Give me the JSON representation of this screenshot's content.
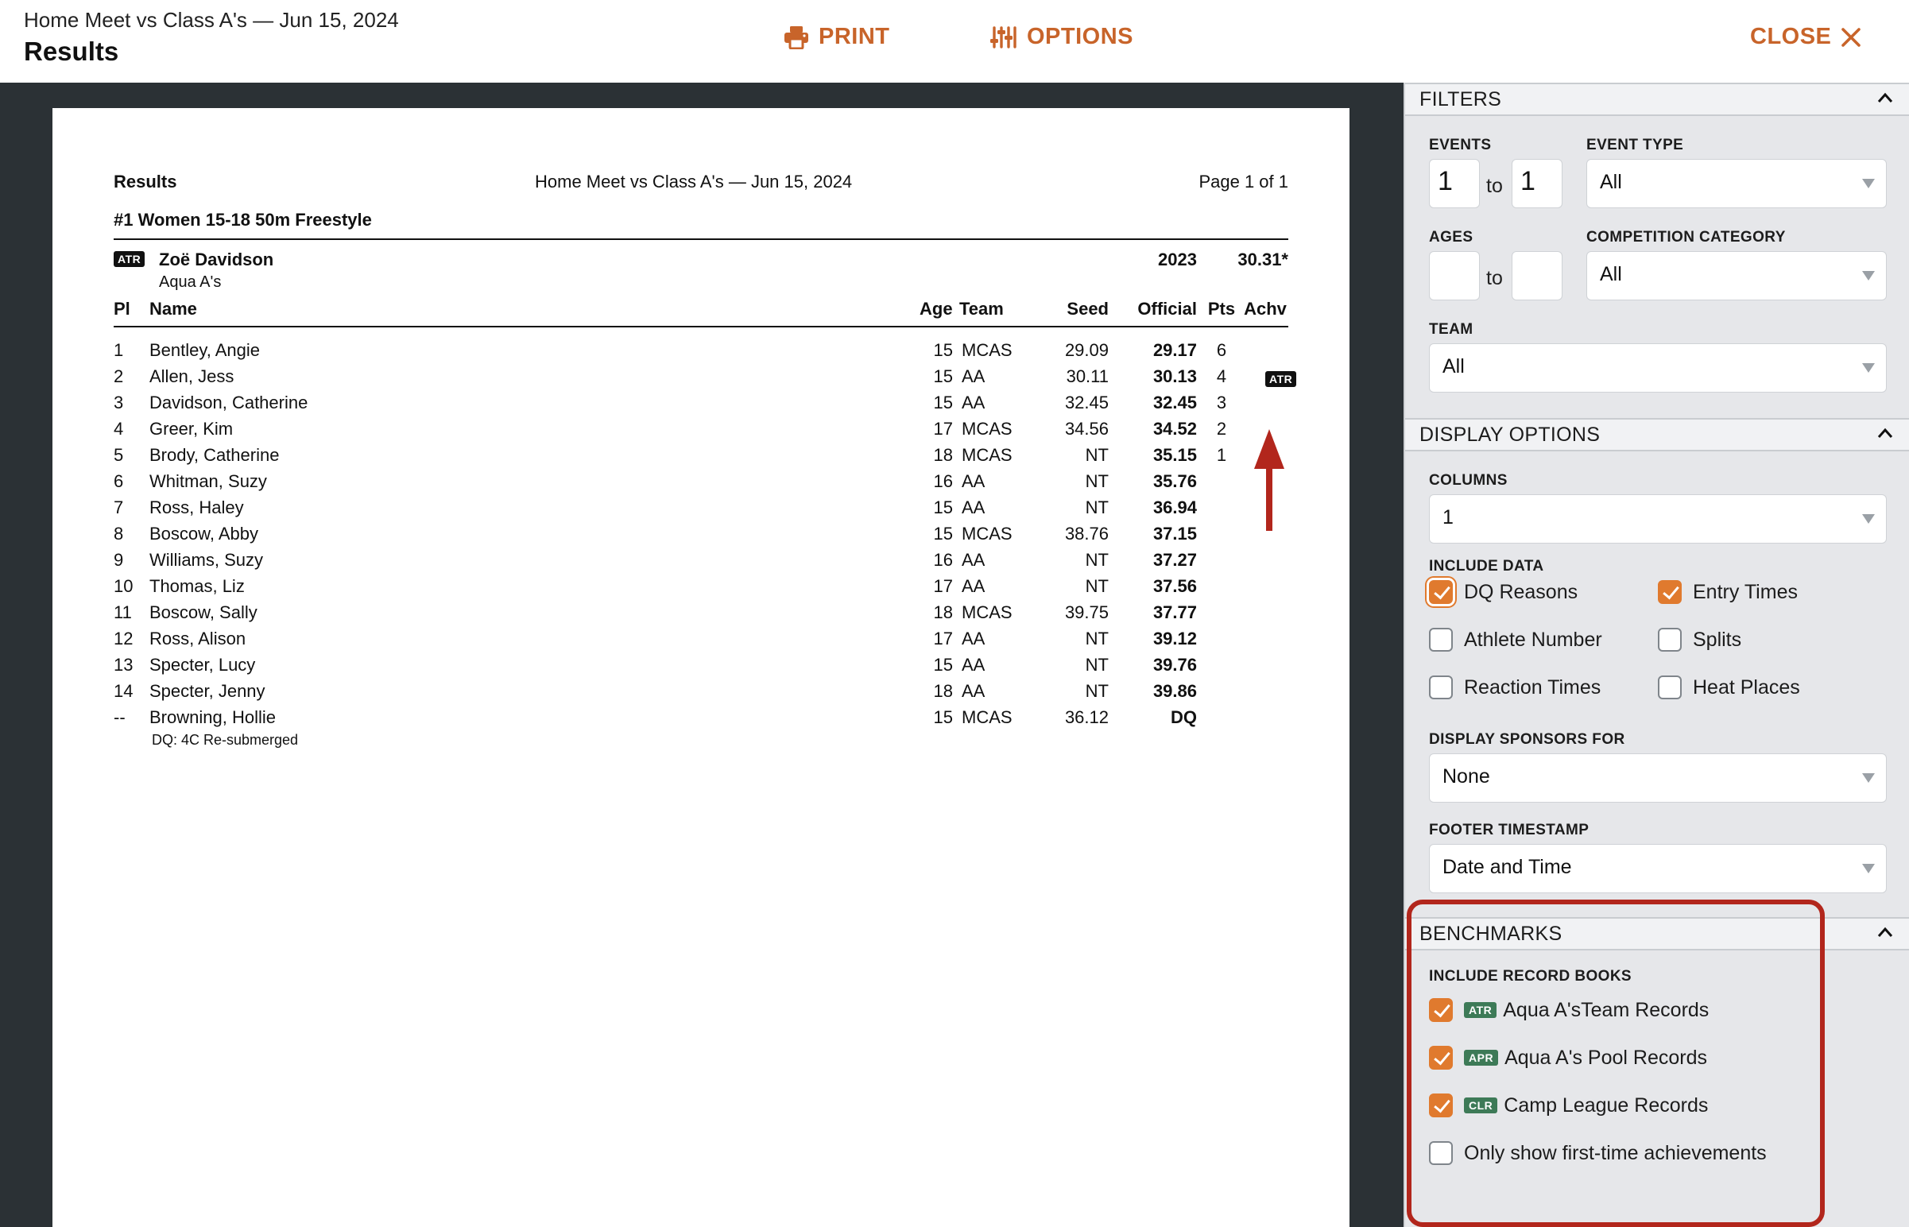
{
  "header": {
    "subtitle": "Home Meet vs Class A's — Jun 15, 2024",
    "title": "Results",
    "print_label": "PRINT",
    "options_label": "OPTIONS",
    "close_label": "CLOSE",
    "accent_color": "#c8642a"
  },
  "document": {
    "head_left": "Results",
    "head_mid": "Home Meet vs Class A's — Jun 15, 2024",
    "head_right": "Page 1 of 1",
    "event_title": "#1 Women 15-18 50m Freestyle",
    "record": {
      "badge": "ATR",
      "name": "Zoë Davidson",
      "team": "Aqua A's",
      "year": "2023",
      "time": "30.31*"
    },
    "columns": {
      "pl": "Pl",
      "name": "Name",
      "age": "Age",
      "team": "Team",
      "seed": "Seed",
      "official": "Official",
      "pts": "Pts",
      "achv": "Achv"
    },
    "rows": [
      {
        "pl": "1",
        "name": "Bentley, Angie",
        "age": "15",
        "team": "MCAS",
        "seed": "29.09",
        "official": "29.17",
        "pts": "6",
        "achv": ""
      },
      {
        "pl": "2",
        "name": "Allen, Jess",
        "age": "15",
        "team": "AA",
        "seed": "30.11",
        "official": "30.13",
        "pts": "4",
        "achv": "ATR"
      },
      {
        "pl": "3",
        "name": "Davidson, Catherine",
        "age": "15",
        "team": "AA",
        "seed": "32.45",
        "official": "32.45",
        "pts": "3",
        "achv": ""
      },
      {
        "pl": "4",
        "name": "Greer, Kim",
        "age": "17",
        "team": "MCAS",
        "seed": "34.56",
        "official": "34.52",
        "pts": "2",
        "achv": ""
      },
      {
        "pl": "5",
        "name": "Brody, Catherine",
        "age": "18",
        "team": "MCAS",
        "seed": "NT",
        "official": "35.15",
        "pts": "1",
        "achv": ""
      },
      {
        "pl": "6",
        "name": "Whitman, Suzy",
        "age": "16",
        "team": "AA",
        "seed": "NT",
        "official": "35.76",
        "pts": "",
        "achv": ""
      },
      {
        "pl": "7",
        "name": "Ross, Haley",
        "age": "15",
        "team": "AA",
        "seed": "NT",
        "official": "36.94",
        "pts": "",
        "achv": ""
      },
      {
        "pl": "8",
        "name": "Boscow, Abby",
        "age": "15",
        "team": "MCAS",
        "seed": "38.76",
        "official": "37.15",
        "pts": "",
        "achv": ""
      },
      {
        "pl": "9",
        "name": "Williams, Suzy",
        "age": "16",
        "team": "AA",
        "seed": "NT",
        "official": "37.27",
        "pts": "",
        "achv": ""
      },
      {
        "pl": "10",
        "name": "Thomas, Liz",
        "age": "17",
        "team": "AA",
        "seed": "NT",
        "official": "37.56",
        "pts": "",
        "achv": ""
      },
      {
        "pl": "11",
        "name": "Boscow, Sally",
        "age": "18",
        "team": "MCAS",
        "seed": "39.75",
        "official": "37.77",
        "pts": "",
        "achv": ""
      },
      {
        "pl": "12",
        "name": "Ross, Alison",
        "age": "17",
        "team": "AA",
        "seed": "NT",
        "official": "39.12",
        "pts": "",
        "achv": ""
      },
      {
        "pl": "13",
        "name": "Specter, Lucy",
        "age": "15",
        "team": "AA",
        "seed": "NT",
        "official": "39.76",
        "pts": "",
        "achv": ""
      },
      {
        "pl": "14",
        "name": "Specter, Jenny",
        "age": "18",
        "team": "AA",
        "seed": "NT",
        "official": "39.86",
        "pts": "",
        "achv": ""
      },
      {
        "pl": "--",
        "name": "Browning, Hollie",
        "age": "15",
        "team": "MCAS",
        "seed": "36.12",
        "official": "DQ",
        "pts": "",
        "achv": ""
      }
    ],
    "dq_note": "DQ: 4C Re-submerged"
  },
  "filters": {
    "section_title": "FILTERS",
    "events_label": "EVENTS",
    "events_from": "1",
    "events_to": "1",
    "to_label": "to",
    "event_type_label": "EVENT TYPE",
    "event_type_value": "All",
    "ages_label": "AGES",
    "ages_from": "",
    "ages_to": "",
    "competition_label": "COMPETITION CATEGORY",
    "competition_value": "All",
    "team_label": "TEAM",
    "team_value": "All"
  },
  "display": {
    "section_title": "DISPLAY OPTIONS",
    "columns_label": "COLUMNS",
    "columns_value": "1",
    "include_data_label": "INCLUDE DATA",
    "dq_reasons": "DQ Reasons",
    "entry_times": "Entry Times",
    "athlete_number": "Athlete Number",
    "splits": "Splits",
    "reaction_times": "Reaction Times",
    "heat_places": "Heat Places",
    "sponsors_label": "DISPLAY SPONSORS FOR",
    "sponsors_value": "None",
    "footer_label": "FOOTER TIMESTAMP",
    "footer_value": "Date and Time"
  },
  "benchmarks": {
    "section_title": "BENCHMARKS",
    "include_label": "INCLUDE RECORD BOOKS",
    "items": [
      {
        "badge": "ATR",
        "label": "Aqua A'sTeam Records"
      },
      {
        "badge": "APR",
        "label": "Aqua A's Pool Records"
      },
      {
        "badge": "CLR",
        "label": "Camp League Records"
      }
    ],
    "first_time_label": "Only show first-time achievements",
    "highlight_color": "#b2261c"
  }
}
